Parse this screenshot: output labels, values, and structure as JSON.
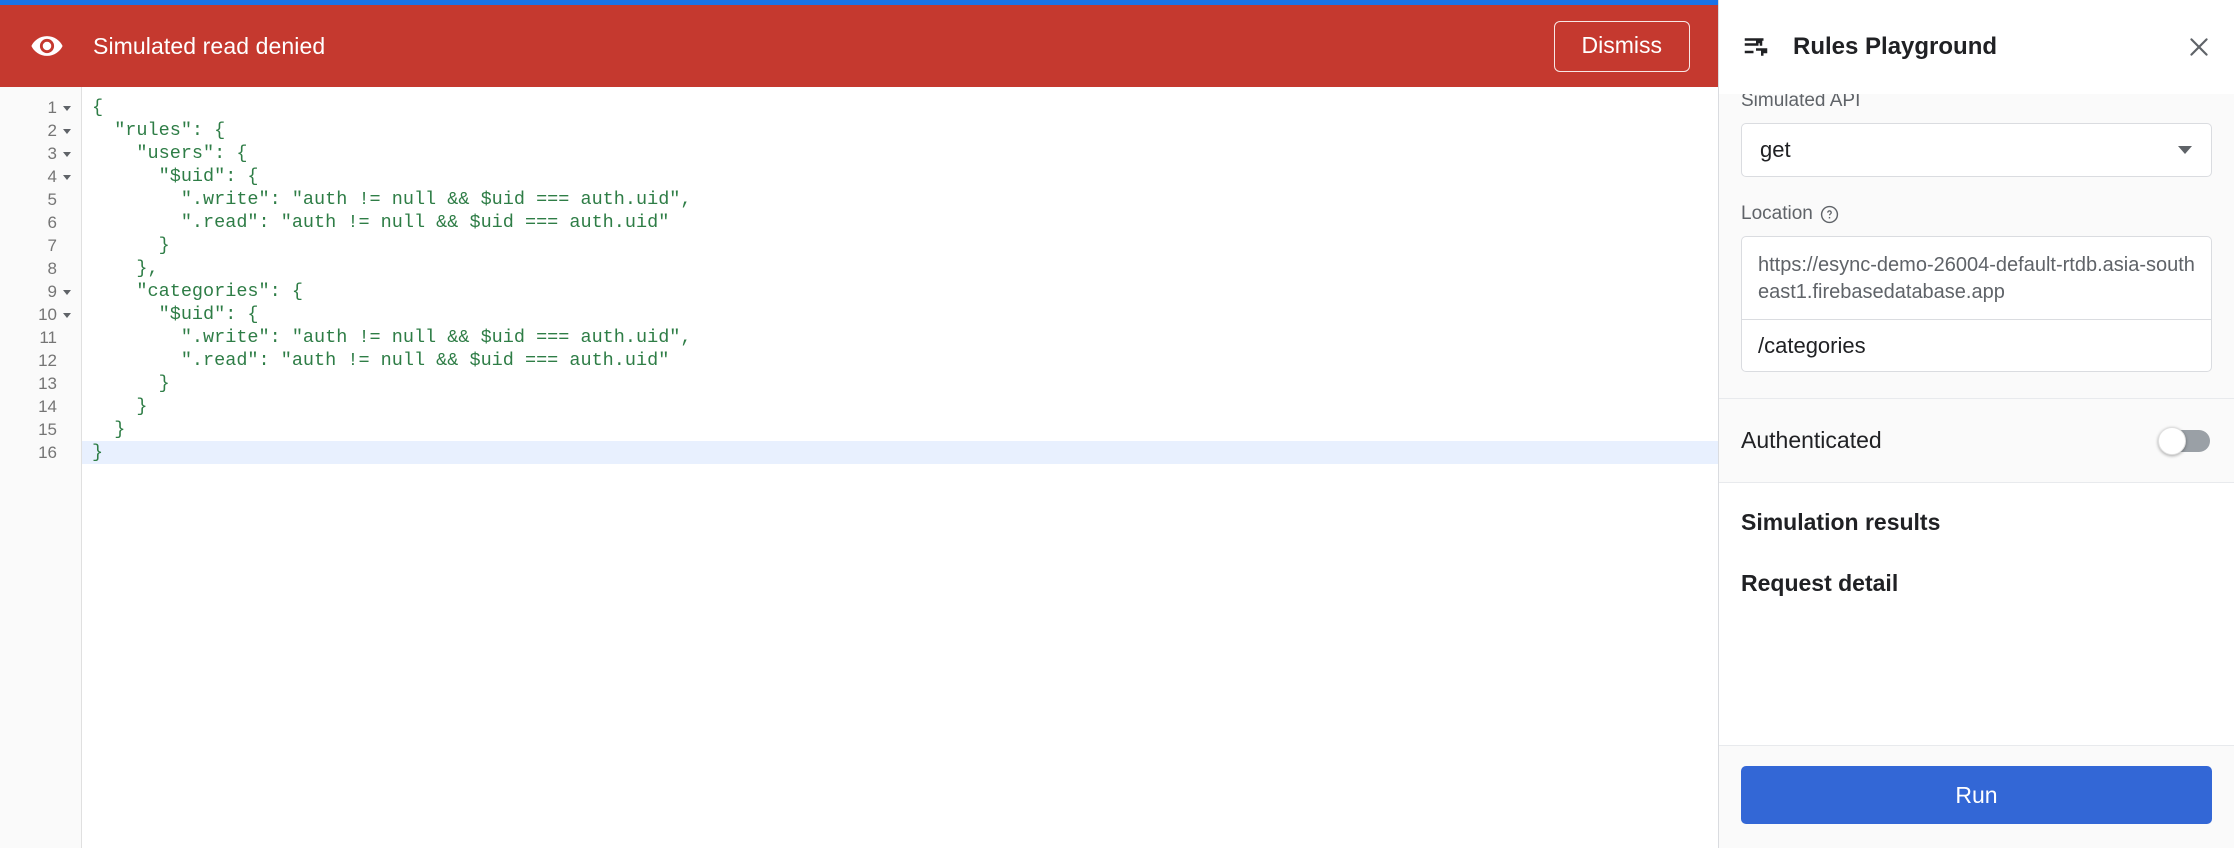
{
  "colors": {
    "banner_bg": "#c5392f",
    "accent_blue": "#1a73e8",
    "run_button": "#3367d6",
    "code_green": "#2e7d46",
    "active_line": "#e8f0fe"
  },
  "top_accent": {
    "present": true
  },
  "banner": {
    "icon": "eye-icon",
    "message": "Simulated read denied",
    "dismiss_label": "Dismiss"
  },
  "editor": {
    "lines": [
      {
        "number": "1",
        "foldable": true,
        "text": "{",
        "active": false
      },
      {
        "number": "2",
        "foldable": true,
        "text": "  \"rules\": {",
        "active": false
      },
      {
        "number": "3",
        "foldable": true,
        "text": "    \"users\": {",
        "active": false
      },
      {
        "number": "4",
        "foldable": true,
        "text": "      \"$uid\": {",
        "active": false
      },
      {
        "number": "5",
        "foldable": false,
        "text": "        \".write\": \"auth != null && $uid === auth.uid\",",
        "active": false
      },
      {
        "number": "6",
        "foldable": false,
        "text": "        \".read\": \"auth != null && $uid === auth.uid\"",
        "active": false
      },
      {
        "number": "7",
        "foldable": false,
        "text": "      }",
        "active": false
      },
      {
        "number": "8",
        "foldable": false,
        "text": "    },",
        "active": false
      },
      {
        "number": "9",
        "foldable": true,
        "text": "    \"categories\": {",
        "active": false
      },
      {
        "number": "10",
        "foldable": true,
        "text": "      \"$uid\": {",
        "active": false
      },
      {
        "number": "11",
        "foldable": false,
        "text": "        \".write\": \"auth != null && $uid === auth.uid\",",
        "active": false
      },
      {
        "number": "12",
        "foldable": false,
        "text": "        \".read\": \"auth != null && $uid === auth.uid\"",
        "active": false
      },
      {
        "number": "13",
        "foldable": false,
        "text": "      }",
        "active": false
      },
      {
        "number": "14",
        "foldable": false,
        "text": "    }",
        "active": false
      },
      {
        "number": "15",
        "foldable": false,
        "text": "  }",
        "active": false
      },
      {
        "number": "16",
        "foldable": false,
        "text": "}",
        "active": true
      }
    ]
  },
  "panel": {
    "icon": "tune-icon",
    "title": "Rules Playground",
    "close_icon": "close-icon",
    "simulated_api": {
      "label": "Simulated API",
      "value": "get"
    },
    "location": {
      "label": "Location",
      "help_icon": "help-circle-icon",
      "url": "https://esync-demo-26004-default-rtdb.asia-southeast1.firebasedatabase.app",
      "path": "/categories"
    },
    "authenticated": {
      "label": "Authenticated",
      "enabled": false
    },
    "results": {
      "title": "Simulation results",
      "subtitle": "Request detail"
    },
    "run_label": "Run"
  }
}
